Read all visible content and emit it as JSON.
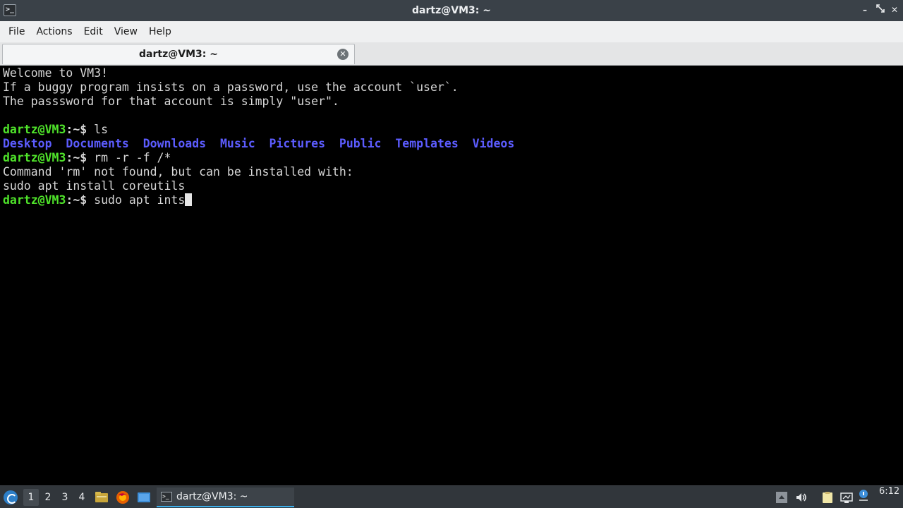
{
  "window": {
    "title": "dartz@VM3: ~",
    "app_icon_glyph": ">_",
    "controls": {
      "minimize": "–",
      "maximize": "✕",
      "close": "✕"
    }
  },
  "menu": {
    "items": [
      "File",
      "Actions",
      "Edit",
      "View",
      "Help"
    ]
  },
  "tabs": [
    {
      "label": "dartz@VM3: ~",
      "close_glyph": "✕"
    }
  ],
  "terminal": {
    "colors": {
      "prompt": "#4fe32a",
      "directory": "#5c5cff",
      "text": "#d7d7d7",
      "background": "#000000"
    },
    "welcome_lines": [
      "Welcome to VM3!",
      "If a buggy program insists on a password, use the account `user`.",
      "The passsword for that account is simply \"user\"."
    ],
    "prompt": "dartz@VM3",
    "prompt_suffix": ":~$",
    "cmd1": " ls",
    "ls_dirs": [
      "Desktop",
      "Documents",
      "Downloads",
      "Music",
      "Pictures",
      "Public",
      "Templates",
      "Videos"
    ],
    "cmd2": " rm -r -f /*",
    "output2": [
      "Command 'rm' not found, but can be installed with:",
      "sudo apt install coreutils"
    ],
    "cmd3": " sudo apt ints"
  },
  "taskbar": {
    "desktops": [
      "1",
      "2",
      "3",
      "4"
    ],
    "active_desktop": "1",
    "quicklaunch": [
      "file-manager-icon",
      "firefox-icon",
      "desktop-icon"
    ],
    "task": {
      "label": "dartz@VM3: ~"
    },
    "tray": [
      "notifications-icon",
      "volume-icon",
      "clipboard-icon",
      "network-icon"
    ],
    "clock": "6:12",
    "accent": "#3daee9"
  }
}
